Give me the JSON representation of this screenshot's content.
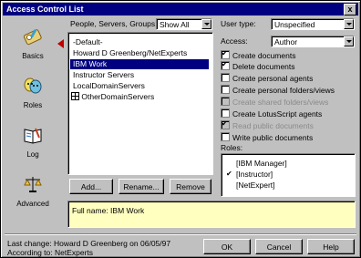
{
  "window": {
    "title": "Access Control List",
    "close_glyph": "x"
  },
  "nav": {
    "items": [
      {
        "label": "Basics",
        "icon": "key-icon"
      },
      {
        "label": "Roles",
        "icon": "masks-icon"
      },
      {
        "label": "Log",
        "icon": "book-icon"
      },
      {
        "label": "Advanced",
        "icon": "scales-icon"
      }
    ]
  },
  "people": {
    "label": "People, Servers, Groups:",
    "filter_value": "Show All",
    "items": [
      {
        "text": "-Default-"
      },
      {
        "text": "Howard D Greenberg/NetExperts"
      },
      {
        "text": "IBM Work",
        "selected": true
      },
      {
        "text": "Instructor Servers"
      },
      {
        "text": "LocalDomainServers"
      },
      {
        "text": "OtherDomainServers",
        "icon": "server-group-icon"
      }
    ]
  },
  "buttons": {
    "add": "Add...",
    "rename": "Rename...",
    "remove": "Remove",
    "ok": "OK",
    "cancel": "Cancel",
    "help": "Help"
  },
  "user_type": {
    "label": "User type:",
    "value": "Unspecified"
  },
  "access": {
    "label": "Access:",
    "value": "Author"
  },
  "permissions": [
    {
      "label": "Create documents",
      "checked": true,
      "disabled": false
    },
    {
      "label": "Delete documents",
      "checked": true,
      "disabled": false
    },
    {
      "label": "Create personal agents",
      "checked": false,
      "disabled": false
    },
    {
      "label": "Create personal folders/views",
      "checked": false,
      "disabled": false
    },
    {
      "label": "Create shared folders/views",
      "checked": false,
      "disabled": true
    },
    {
      "label": "Create LotusScript agents",
      "checked": false,
      "disabled": false
    },
    {
      "label": "Read public documents",
      "checked": true,
      "disabled": true
    },
    {
      "label": "Write public documents",
      "checked": false,
      "disabled": false
    }
  ],
  "roles": {
    "label": "Roles:",
    "items": [
      {
        "text": "[IBM Manager]",
        "checked": false
      },
      {
        "text": "[Instructor]",
        "checked": true
      },
      {
        "text": "[NetExpert]",
        "checked": false
      }
    ]
  },
  "full_name": "Full name: IBM Work",
  "status": {
    "last_change": "Last change: Howard D Greenberg on 06/05/97",
    "according_to": "According to: NetExperts"
  },
  "colors": {
    "title_bar": "#000080",
    "selection": "#000080",
    "info_panel": "#ffffc0",
    "active_marker": "#c00000"
  }
}
